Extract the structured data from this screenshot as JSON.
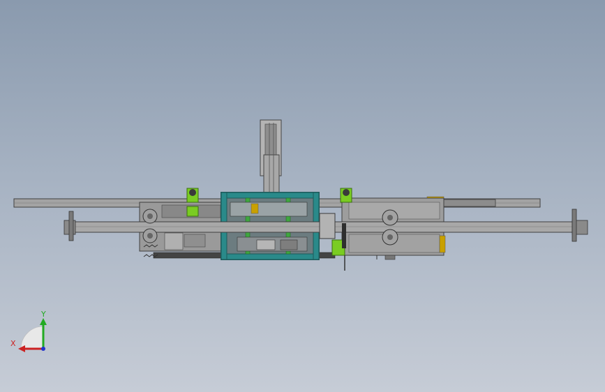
{
  "view": {
    "background_top": "#8a9aae",
    "background_bottom": "#c6ccd6"
  },
  "axis_triad": {
    "x_label": "X",
    "y_label": "Y",
    "x_color": "#cc2222",
    "y_color": "#22aa22",
    "z_color": "#2233cc"
  },
  "assembly": {
    "frame_color": "#2a8a8a",
    "bracket_color": "#7acc22",
    "beam_color": "#9a9a9a"
  }
}
